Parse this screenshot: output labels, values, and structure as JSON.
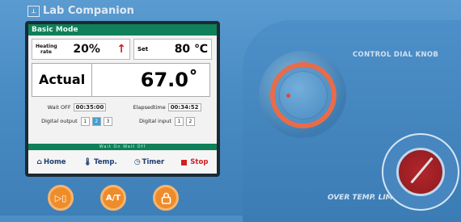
{
  "brand": {
    "name": "Lab Companion",
    "logo_icon": "lab-companion-logo"
  },
  "screen": {
    "mode_title": "Basic Mode",
    "heating_rate_label": "Heating rate",
    "heating_rate_value": "20%",
    "heating_rate_trend": "up-arrow-red",
    "set_label": "Set",
    "set_value": "80 ℃",
    "actual_label": "Actual",
    "actual_value": "67.0˚",
    "wait_off_label": "Wait OFF",
    "wait_off_value": "00:35:00",
    "elapsed_label": "Elapsedtime",
    "elapsed_value": "00:34:52",
    "digital_output_label": "Digital output",
    "digital_output_channels": [
      "1",
      "2",
      "3"
    ],
    "digital_output_active": "2",
    "digital_input_label": "Digital input",
    "digital_input_channels": [
      "1",
      "2"
    ],
    "status_text": "Wait On    Wait Off",
    "nav": {
      "home": "Home",
      "temp": "Temp.",
      "timer": "Timer",
      "stop": "Stop"
    }
  },
  "controls": {
    "dial_label": "CONTROL DIAL KNOB",
    "limit_label": "OVER TEMP. LIMIT",
    "btn_run_label": "▷▯",
    "btn_at_label": "A/T",
    "btn_lock_icon": "lock-icon"
  },
  "colors": {
    "panel": "#4a8cc4",
    "lcd_header": "#10805a",
    "accent_orange": "#ef8c2a",
    "stop_red": "#d21f1f"
  }
}
